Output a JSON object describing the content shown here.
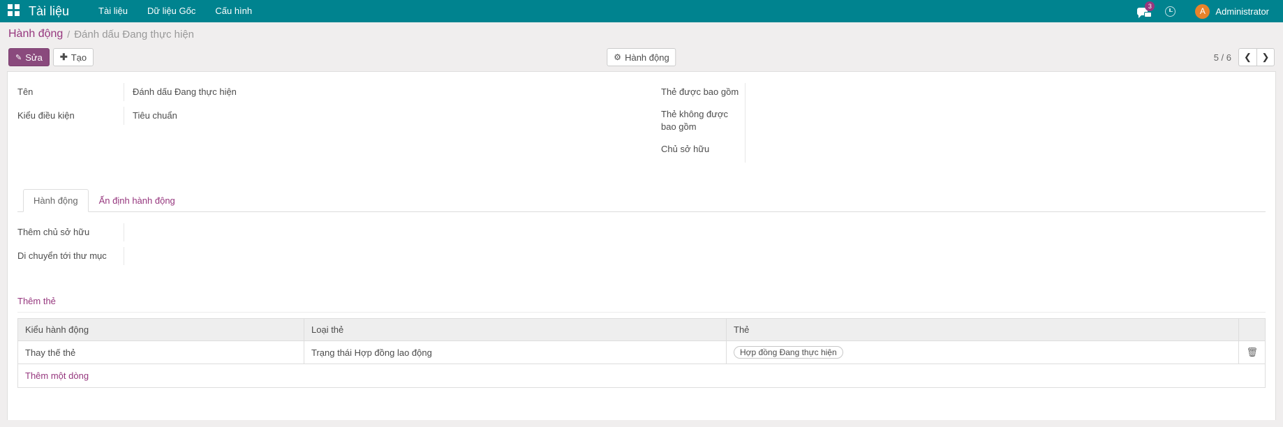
{
  "navbar": {
    "apps_icon": "apps-grid-icon",
    "brand": "Tài liệu",
    "menu": [
      {
        "label": "Tài liệu"
      },
      {
        "label": "Dữ liệu Gốc"
      },
      {
        "label": "Cấu hình"
      }
    ],
    "messages": {
      "icon": "chat-bubble-icon",
      "badge": "3"
    },
    "activity": {
      "icon": "clock-icon"
    },
    "user": {
      "avatar_initial": "A",
      "name": "Administrator"
    },
    "colors": {
      "background": "#00838f",
      "badge": "#96377e",
      "avatar": "#e8832a"
    }
  },
  "breadcrumb": {
    "parent": "Hành động",
    "separator": "/",
    "current": "Đánh dấu Đang thực hiện"
  },
  "control_panel": {
    "edit_label": "Sửa",
    "edit_icon": "pencil-icon",
    "create_label": "Tạo",
    "create_icon": "plus-icon",
    "action_label": "Hành động",
    "action_icon": "gear-icon",
    "pager": {
      "text": "5 / 6",
      "prev_icon": "chevron-left-icon",
      "next_icon": "chevron-right-icon"
    },
    "accent": "#8a4a7d"
  },
  "form": {
    "left_fields": [
      {
        "label": "Tên",
        "value": "Đánh dấu Đang thực hiện"
      },
      {
        "label": "Kiểu điều kiện",
        "value": "Tiêu chuẩn"
      }
    ],
    "right_fields": [
      {
        "label": "Thẻ được bao gồm",
        "value": ""
      },
      {
        "label": "Thẻ không được bao gồm",
        "value": ""
      },
      {
        "label": "Chủ sở hữu",
        "value": ""
      }
    ]
  },
  "notebook": {
    "tabs": [
      {
        "label": "Hành động",
        "active": true
      },
      {
        "label": "Ấn định hành động",
        "active": false
      }
    ],
    "page_fields": [
      {
        "label": "Thêm chủ sở hữu",
        "value": ""
      },
      {
        "label": "Di chuyển tới thư mục",
        "value": ""
      }
    ],
    "section_title": "Thêm thẻ",
    "table": {
      "headers": [
        "Kiểu hành động",
        "Loại thẻ",
        "Thẻ",
        ""
      ],
      "rows": [
        {
          "kind": "Thay thế thẻ",
          "tag_type": "Trạng thái Hợp đồng lao động",
          "tags": [
            "Hợp đồng Đang thực hiện"
          ],
          "delete_icon": "trash-icon"
        }
      ],
      "add_line_label": "Thêm một dòng"
    }
  }
}
